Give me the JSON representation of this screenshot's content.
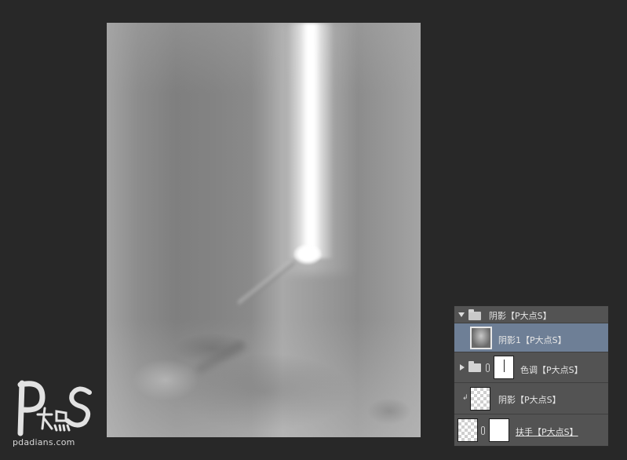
{
  "canvas": {
    "description_colors": {
      "background": "#282828",
      "beam": "#ffffff"
    }
  },
  "logo": {
    "url_text": "pdadians.com"
  },
  "layers_panel": {
    "layers": [
      {
        "name": "阴影【P大点S】",
        "type": "group",
        "expanded": true,
        "selected": false
      },
      {
        "name": "阴影1【P大点S】",
        "type": "pixel",
        "selected": true
      },
      {
        "name": "色调【P大点S】",
        "type": "group",
        "expanded": false,
        "selected": false,
        "has_mask": true
      },
      {
        "name": "阴影【P大点S】",
        "type": "pixel",
        "clipped": true,
        "selected": false
      },
      {
        "name": "扶手【P大点S】",
        "type": "pixel",
        "has_mask": true,
        "selected": false
      }
    ]
  },
  "icons": {
    "group_expand": "triangle-down-icon",
    "group_collapse": "triangle-right-icon",
    "folder": "folder-icon",
    "link": "chain-link-icon",
    "clip": "clip-arrow-icon"
  }
}
